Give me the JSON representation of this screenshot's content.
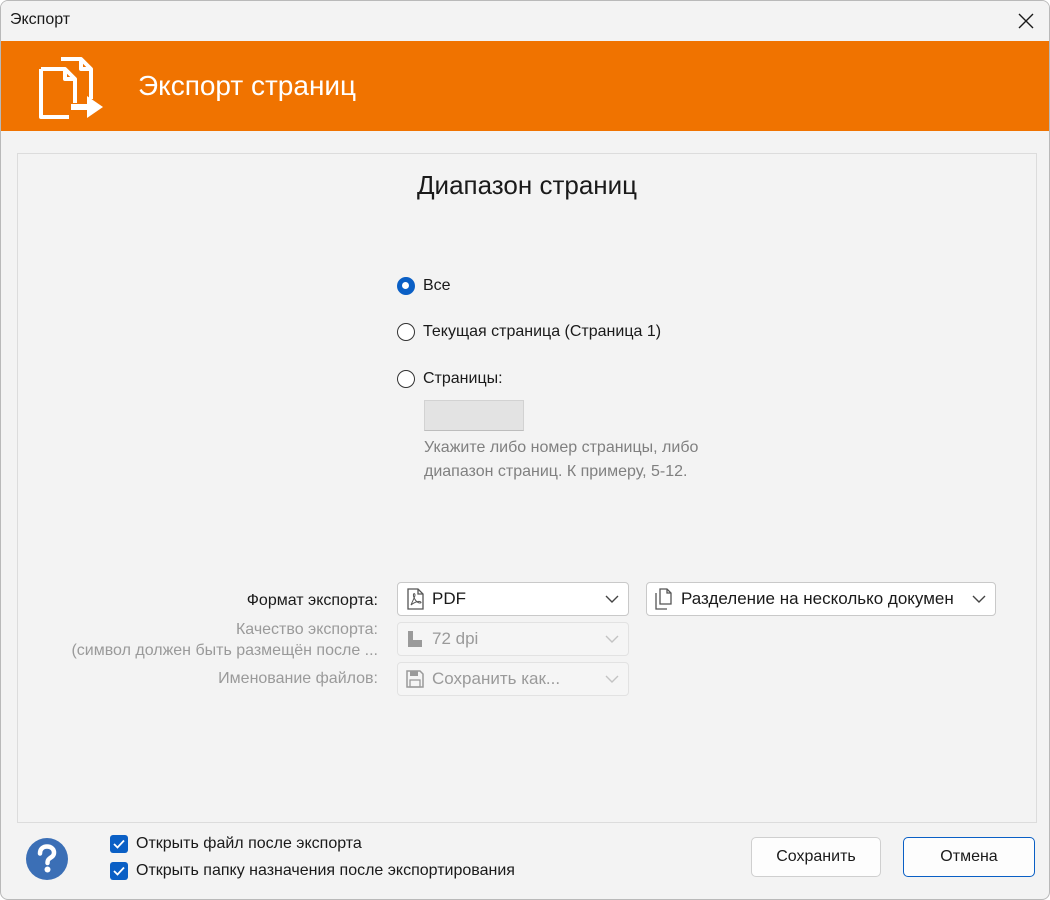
{
  "window": {
    "title": "Экспорт"
  },
  "banner": {
    "title": "Экспорт страниц",
    "color": "#f07300"
  },
  "range": {
    "title": "Диапазон страниц",
    "options": [
      {
        "label": "Все",
        "checked": true
      },
      {
        "label": "Текущая страница (Страница 1)",
        "checked": false
      },
      {
        "label": "Страницы:",
        "checked": false
      }
    ],
    "pages_value": "",
    "hint": "Укажите либо номер страницы, либо диапазон страниц. К примеру, 5-12."
  },
  "export": {
    "format_label": "Формат экспорта:",
    "format_value": "PDF",
    "split_value": "Разделение на несколько докумен",
    "quality_label": "Качество экспорта:",
    "quality_note": "(символ  должен быть размещён после ...",
    "quality_value": "72 dpi",
    "naming_label": "Именование файлов:",
    "naming_value": "Сохранить как..."
  },
  "footer": {
    "open_file": "Открыть файл после экспорта",
    "open_folder": "Открыть папку назначения после экспортирования",
    "save_button": "Сохранить",
    "cancel_button": "Отмена"
  },
  "colors": {
    "accent": "#0a5fc5",
    "help": "#3b6fb6"
  }
}
